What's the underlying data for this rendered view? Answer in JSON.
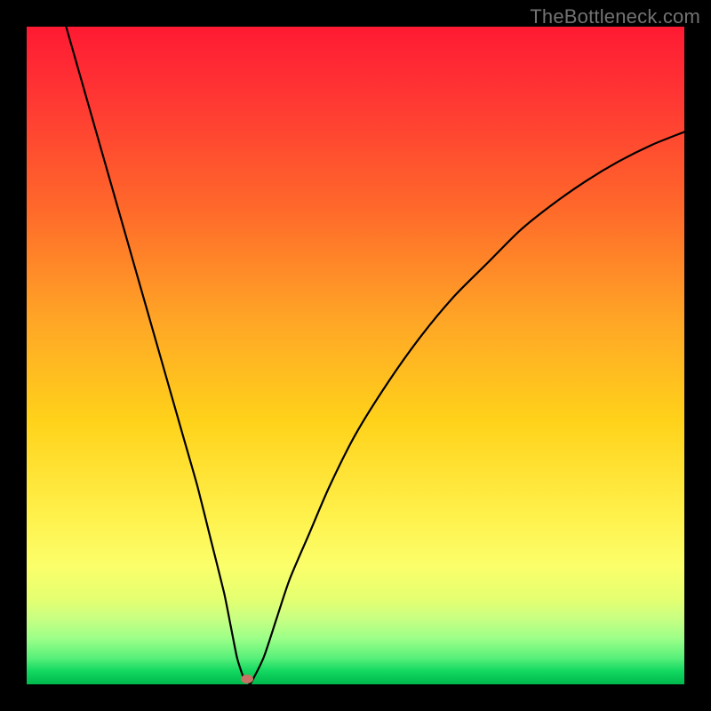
{
  "watermark": "TheBottleneck.com",
  "chart_data": {
    "type": "line",
    "title": "",
    "xlabel": "",
    "ylabel": "",
    "xlim": [
      0,
      100
    ],
    "ylim": [
      0,
      100
    ],
    "series": [
      {
        "name": "bottleneck-curve",
        "x": [
          6,
          8,
          10,
          12,
          14,
          16,
          18,
          20,
          22,
          24,
          26,
          28,
          30,
          31,
          32,
          33,
          34,
          36,
          38,
          40,
          43,
          46,
          50,
          55,
          60,
          65,
          70,
          75,
          80,
          85,
          90,
          95,
          100
        ],
        "values": [
          100,
          93,
          86,
          79,
          72,
          65,
          58,
          51,
          44,
          37,
          30,
          22,
          14,
          9,
          4,
          1,
          0,
          4,
          10,
          16,
          23,
          30,
          38,
          46,
          53,
          59,
          64,
          69,
          73,
          76.5,
          79.5,
          82,
          84
        ]
      }
    ],
    "marker": {
      "x": 33.5,
      "y": 0.8
    },
    "background_gradient": {
      "top": "#ff1a33",
      "bottom": "#00b84c"
    }
  }
}
